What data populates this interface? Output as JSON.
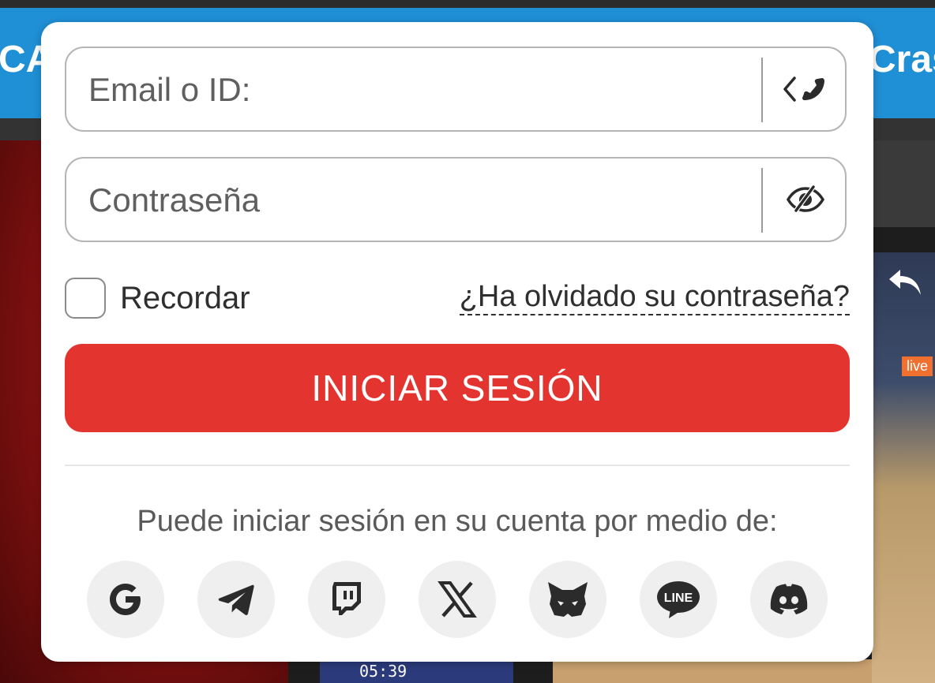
{
  "background": {
    "left_banner_text": "CA",
    "right_banner_text": "Cras",
    "live_badge": "live",
    "score_time": "05:39"
  },
  "login": {
    "email_placeholder": "Email o ID:",
    "password_placeholder": "Contraseña",
    "remember_label": "Recordar",
    "forgot_password": "¿Ha olvidado su contraseña?",
    "submit_label": "INICIAR SESIÓN",
    "social_caption": "Puede iniciar sesión en su cuenta por medio de:",
    "social_providers": [
      "google",
      "telegram",
      "twitch",
      "x",
      "metamask",
      "line",
      "discord"
    ],
    "line_icon_text": "LINE"
  },
  "colors": {
    "accent_red": "#e3342f",
    "brand_blue": "#1f8fd6",
    "icon_dark": "#2b2b2b"
  }
}
